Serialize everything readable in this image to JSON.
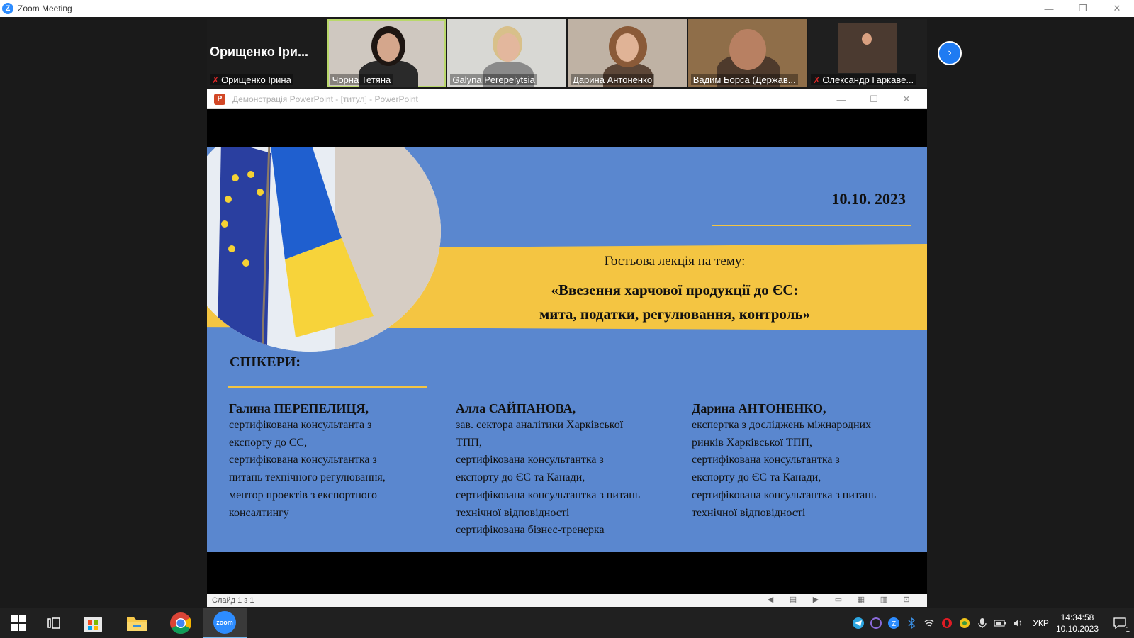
{
  "zoom": {
    "window_title": "Zoom Meeting",
    "minimize": "—",
    "restore": "❐",
    "close": "✕"
  },
  "gallery": {
    "active_speaker_big_name": "Орищенко Іри...",
    "participants": [
      {
        "name": "Орищенко Ірина",
        "muted": true
      },
      {
        "name": "Чорна Тетяна",
        "muted": false
      },
      {
        "name": "Galyna Perepelytsia",
        "muted": false
      },
      {
        "name": "Дарина Антоненко",
        "muted": false
      },
      {
        "name": "Вадим Борса (Держав...",
        "muted": false
      },
      {
        "name": "Олександр Гаркаве...",
        "muted": true
      }
    ],
    "next_page": "›"
  },
  "ppt": {
    "window_title": "Демонстрація PowerPoint - [титул] - PowerPoint",
    "icon_letter": "P",
    "minimize": "—",
    "maximize": "☐",
    "close": "✕",
    "status_slide": "Слайд 1 з 1"
  },
  "slide": {
    "date": "10.10. 2023",
    "intro": "Гостьова лекція на тему:",
    "title_line1": "«Ввезення харчової продукції до ЄС:",
    "title_line2": "мита, податки, регулювання, контроль»",
    "speakers_heading": "СПІКЕРИ:",
    "speakers": [
      {
        "name": "Галина ПЕРЕПЕЛИЦЯ,",
        "lines": [
          "сертифікована консультанта з",
          "експорту до ЄС,",
          "сертифікована консультантка з",
          "питань технічного регулювання,",
          "ментор проектів з експортного",
          "консалтингу"
        ]
      },
      {
        "name": "Алла САЙПАНОВА,",
        "lines": [
          "зав. сектора аналітики Харківської",
          "ТПП,",
          "сертифікована консультантка з",
          "експорту до ЄС та Канади,",
          "сертифікована консультантка з питань",
          "технічної відповідності",
          "сертифікована бізнес-тренерка"
        ]
      },
      {
        "name": "Дарина АНТОНЕНКО,",
        "lines": [
          "експертка з досліджень міжнародних",
          "ринків Харківської ТПП,",
          "сертифікована консультантка з",
          "експорту до ЄС та Канади,",
          "сертифікована консультантка з питань",
          "технічної відповідності"
        ]
      }
    ]
  },
  "taskbar": {
    "language": "УКР",
    "time": "14:34:58",
    "date": "10.10.2023",
    "zoom_label": "zoom",
    "notifications": "1"
  },
  "colors": {
    "slide_blue": "#5a87cf",
    "slide_yellow": "#f4c542",
    "zoom_blue": "#2D8CFF"
  }
}
